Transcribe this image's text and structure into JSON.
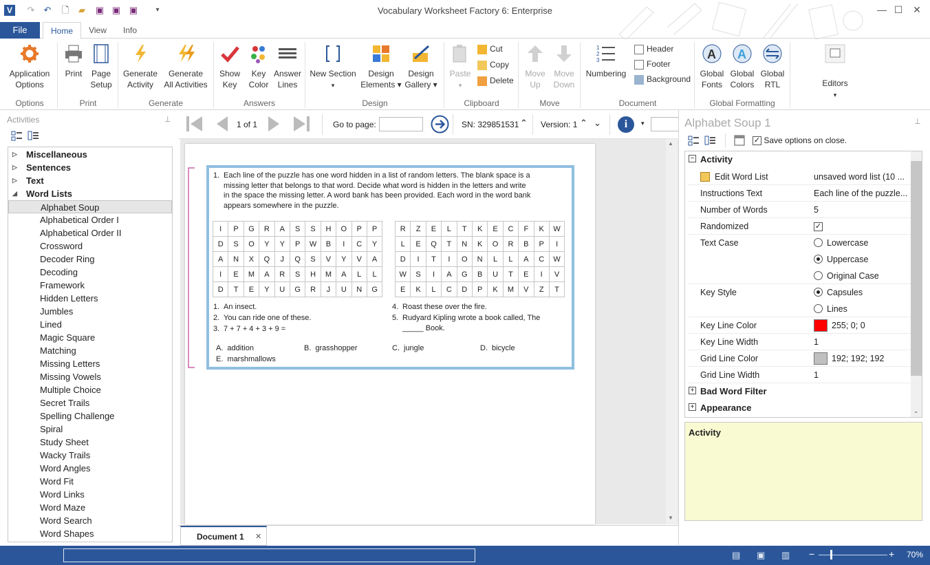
{
  "window": {
    "title": "Vocabulary Worksheet Factory 6: Enterprise"
  },
  "tabs": {
    "file": "File",
    "home": "Home",
    "view": "View",
    "info": "Info"
  },
  "ribbon": {
    "options": {
      "app_options_1": "Application",
      "app_options_2": "Options",
      "group": "Options"
    },
    "print": {
      "print": "Print",
      "page_setup_1": "Page",
      "page_setup_2": "Setup",
      "group": "Print"
    },
    "generate": {
      "gen_activity_1": "Generate",
      "gen_activity_2": "Activity",
      "gen_all_1": "Generate",
      "gen_all_2": "All Activities",
      "group": "Generate"
    },
    "answers": {
      "show_key_1": "Show",
      "show_key_2": "Key",
      "key_color_1": "Key",
      "key_color_2": "Color",
      "answer_lines_1": "Answer",
      "answer_lines_2": "Lines",
      "group": "Answers"
    },
    "design": {
      "new_section": "New Section",
      "design_elements_1": "Design",
      "design_elements_2": "Elements",
      "design_gallery_1": "Design",
      "design_gallery_2": "Gallery",
      "group": "Design"
    },
    "clipboard": {
      "paste": "Paste",
      "cut": "Cut",
      "copy": "Copy",
      "delete": "Delete",
      "group": "Clipboard"
    },
    "move": {
      "move_up_1": "Move",
      "move_up_2": "Up",
      "move_down_1": "Move",
      "move_down_2": "Down",
      "group": "Move"
    },
    "document": {
      "numbering": "Numbering",
      "header": "Header",
      "footer": "Footer",
      "background": "Background",
      "group": "Document"
    },
    "global": {
      "fonts_1": "Global",
      "fonts_2": "Fonts",
      "colors_1": "Global",
      "colors_2": "Colors",
      "rtl_1": "Global",
      "rtl_2": "RTL",
      "group": "Global Formatting"
    },
    "editors": {
      "label": "Editors"
    }
  },
  "left_panel": {
    "title": "Activities",
    "categories": [
      "Miscellaneous",
      "Sentences",
      "Text",
      "Word Lists"
    ],
    "word_lists": [
      "Alphabet Soup",
      "Alphabetical Order I",
      "Alphabetical Order II",
      "Crossword",
      "Decoder Ring",
      "Decoding",
      "Framework",
      "Hidden Letters",
      "Jumbles",
      "Lined",
      "Magic Square",
      "Matching",
      "Missing Letters",
      "Missing Vowels",
      "Multiple Choice",
      "Secret Trails",
      "Spelling Challenge",
      "Spiral",
      "Study Sheet",
      "Wacky Trails",
      "Word Angles",
      "Word Fit",
      "Word Links",
      "Word Maze",
      "Word Search",
      "Word Shapes"
    ],
    "selected": "Alphabet Soup"
  },
  "navbar": {
    "page": "1 of 1",
    "goto_label": "Go to page:",
    "goto_value": "",
    "sn": "SN: 329851531",
    "version": "Version: 1"
  },
  "worksheet": {
    "number": "1.",
    "instructions": [
      "Each line of the puzzle has one word hidden in a list of random letters. The blank space is a",
      "missing letter that belongs to that word. Decide what word is hidden in the letters and write",
      "in the space the missing letter. A word bank has been provided. Each word in the word bank",
      "appears somewhere in the puzzle."
    ],
    "grid_left": [
      [
        "I",
        "P",
        "G",
        "R",
        "A",
        "S",
        "S",
        "H",
        "O",
        "P",
        "P"
      ],
      [
        "D",
        "S",
        "O",
        "Y",
        "Y",
        "P",
        "W",
        "B",
        "I",
        "C",
        "Y"
      ],
      [
        "A",
        "N",
        "X",
        "Q",
        "J",
        "Q",
        "S",
        "V",
        "Y",
        "V",
        "A"
      ],
      [
        "I",
        "E",
        "M",
        "A",
        "R",
        "S",
        "H",
        "M",
        "A",
        "L",
        "L"
      ],
      [
        "D",
        "T",
        "E",
        "Y",
        "U",
        "G",
        "R",
        "J",
        "U",
        "N",
        "G"
      ]
    ],
    "grid_right": [
      [
        "R",
        "Z",
        "E",
        "L",
        "T",
        "K",
        "E",
        "C",
        "F",
        "K",
        "W"
      ],
      [
        "L",
        "E",
        "Q",
        "T",
        "N",
        "K",
        "O",
        "R",
        "B",
        "P",
        "I"
      ],
      [
        "D",
        "I",
        "T",
        "I",
        "O",
        "N",
        "L",
        "L",
        "A",
        "C",
        "W"
      ],
      [
        "W",
        "S",
        "I",
        "A",
        "G",
        "B",
        "U",
        "T",
        "E",
        "I",
        "V"
      ],
      [
        "E",
        "K",
        "L",
        "C",
        "D",
        "P",
        "K",
        "M",
        "V",
        "Z",
        "T"
      ]
    ],
    "clues_left": [
      [
        "1.",
        "An insect."
      ],
      [
        "2.",
        "You can ride one of these."
      ],
      [
        "3.",
        "7 + 7 + 4 + 3 + 9 ="
      ]
    ],
    "clues_right": [
      [
        "4.",
        "Roast these over the fire."
      ],
      [
        "5.",
        "Rudyard Kipling wrote a book called, The"
      ]
    ],
    "clue5_cont": "_____ Book.",
    "bank": [
      [
        "A.",
        "addition"
      ],
      [
        "B.",
        "grasshopper"
      ],
      [
        "C.",
        "jungle"
      ],
      [
        "D.",
        "bicycle"
      ],
      [
        "E.",
        "marshmallows"
      ]
    ]
  },
  "doc_tab": {
    "label": "Document 1"
  },
  "right_panel": {
    "title": "Alphabet Soup 1",
    "save_on_close": "Save options on close.",
    "section_activity": "Activity",
    "props": {
      "edit_word_list": {
        "name": "Edit Word List",
        "value": "unsaved word list (10 ..."
      },
      "instructions": {
        "name": "Instructions Text",
        "value": "Each line of the puzzle..."
      },
      "num_words": {
        "name": "Number of Words",
        "value": "5"
      },
      "randomized": {
        "name": "Randomized",
        "value": "✓"
      },
      "text_case": {
        "name": "Text Case",
        "options": [
          "Lowercase",
          "Uppercase",
          "Original Case"
        ],
        "selected": "Uppercase"
      },
      "key_style": {
        "name": "Key Style",
        "options": [
          "Capsules",
          "Lines"
        ],
        "selected": "Capsules"
      },
      "key_line_color": {
        "name": "Key Line Color",
        "value": "255; 0; 0",
        "swatch": "#ff0000"
      },
      "key_line_width": {
        "name": "Key Line Width",
        "value": "1"
      },
      "grid_line_color": {
        "name": "Grid Line Color",
        "value": "192; 192; 192",
        "swatch": "#c0c0c0"
      },
      "grid_line_width": {
        "name": "Grid Line Width",
        "value": "1"
      }
    },
    "section_bad_word": "Bad Word Filter",
    "section_appearance": "Appearance",
    "help_title": "Activity"
  },
  "status": {
    "zoom": "70%"
  },
  "colors": {
    "accent": "#2b579a",
    "help_bg": "#fafad2",
    "frame": "#8fbfe0",
    "bracket": "#cc66aa"
  }
}
